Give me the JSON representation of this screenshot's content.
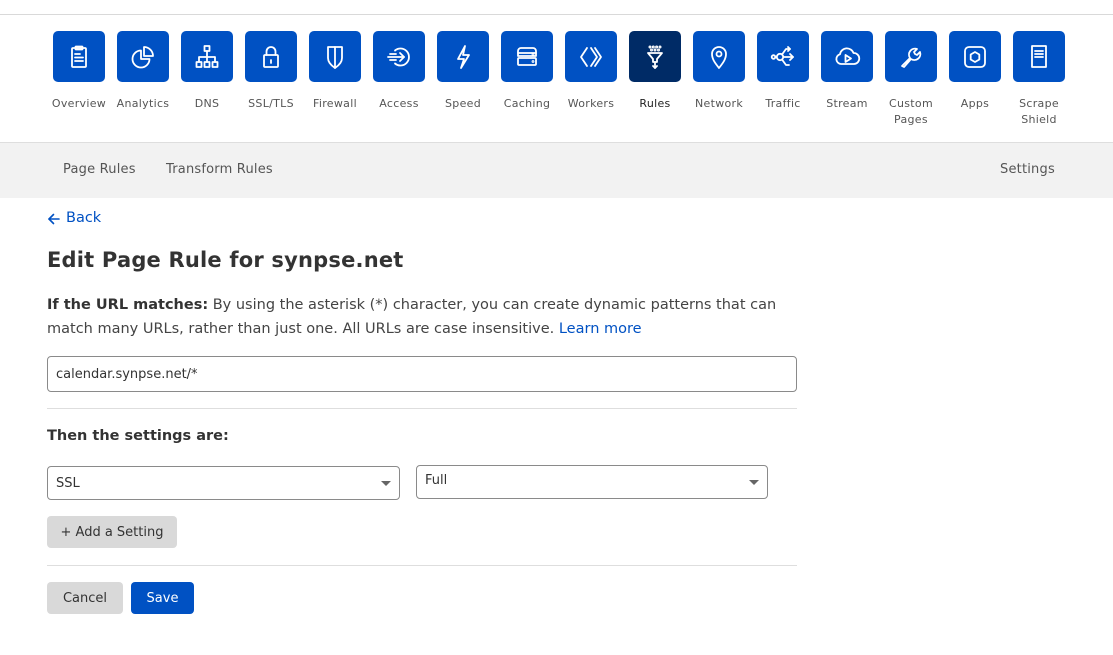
{
  "app_nav": {
    "items": [
      {
        "label": "Overview",
        "icon": "clipboard-icon",
        "active": false
      },
      {
        "label": "Analytics",
        "icon": "pie-chart-icon",
        "active": false
      },
      {
        "label": "DNS",
        "icon": "sitemap-icon",
        "active": false
      },
      {
        "label": "SSL/TLS",
        "icon": "lock-icon",
        "active": false
      },
      {
        "label": "Firewall",
        "icon": "shield-icon",
        "active": false
      },
      {
        "label": "Access",
        "icon": "access-arrow-icon",
        "active": false
      },
      {
        "label": "Speed",
        "icon": "lightning-icon",
        "active": false
      },
      {
        "label": "Caching",
        "icon": "server-stack-icon",
        "active": false
      },
      {
        "label": "Workers",
        "icon": "workers-chevrons-icon",
        "active": false
      },
      {
        "label": "Rules",
        "icon": "funnel-icon",
        "active": true
      },
      {
        "label": "Network",
        "icon": "map-pin-icon",
        "active": false
      },
      {
        "label": "Traffic",
        "icon": "traffic-split-icon",
        "active": false
      },
      {
        "label": "Stream",
        "icon": "cloud-play-icon",
        "active": false
      },
      {
        "label": "Custom\nPages",
        "icon": "wrench-icon",
        "active": false
      },
      {
        "label": "Apps",
        "icon": "hexagon-app-icon",
        "active": false
      },
      {
        "label": "Scrape\nShield",
        "icon": "document-icon",
        "active": false
      }
    ]
  },
  "sub_nav": {
    "page_rules": "Page Rules",
    "transform_rules": "Transform Rules",
    "settings": "Settings"
  },
  "back_label": "Back",
  "page_title": "Edit Page Rule for synpse.net",
  "url_section": {
    "label": "If the URL matches:",
    "description": " By using the asterisk (*) character, you can create dynamic patterns that can match many URLs, rather than just one. All URLs are case insensitive. ",
    "learn_more": "Learn more",
    "url_value": "calendar.synpse.net/*"
  },
  "settings_section": {
    "label": "Then the settings are:",
    "setting_select": "SSL",
    "value_select": "Full",
    "add_setting_label": "+ Add a Setting"
  },
  "actions": {
    "cancel": "Cancel",
    "save": "Save"
  },
  "colors": {
    "brand_blue": "#0051c3",
    "active_tile": "#002b66"
  }
}
